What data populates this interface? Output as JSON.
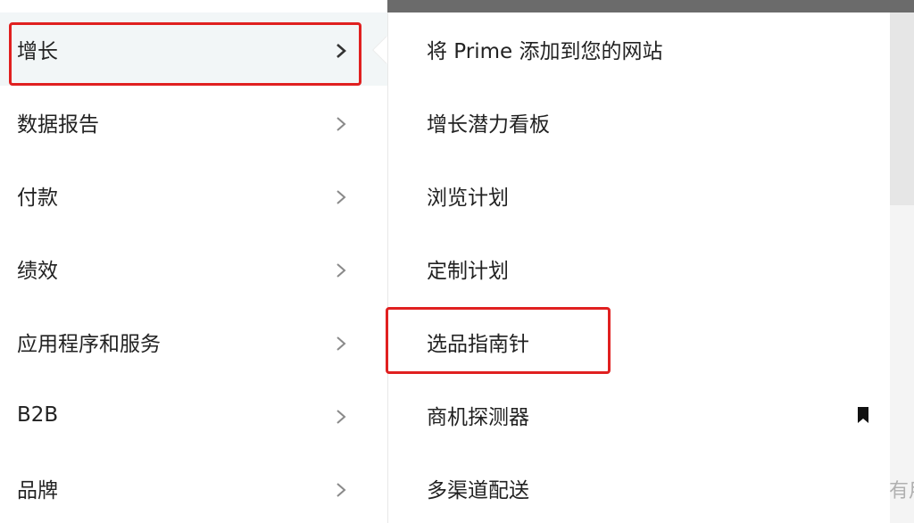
{
  "main_menu": {
    "items": [
      {
        "label": "增长",
        "active": true
      },
      {
        "label": "数据报告"
      },
      {
        "label": "付款"
      },
      {
        "label": "绩效"
      },
      {
        "label": "应用程序和服务"
      },
      {
        "label": "B2B"
      },
      {
        "label": "品牌"
      }
    ]
  },
  "sub_menu": {
    "items": [
      {
        "label": "将 Prime 添加到您的网站"
      },
      {
        "label": "增长潜力看板"
      },
      {
        "label": "浏览计划"
      },
      {
        "label": "定制计划"
      },
      {
        "label": "选品指南针"
      },
      {
        "label": "商机探测器",
        "icon": "bookmark-icon"
      },
      {
        "label": "多渠道配送"
      }
    ]
  },
  "background": {
    "peek_text": "有用"
  },
  "colors": {
    "highlight_border": "#e02020",
    "active_bg": "#f2f6f7",
    "text": "#222222"
  }
}
